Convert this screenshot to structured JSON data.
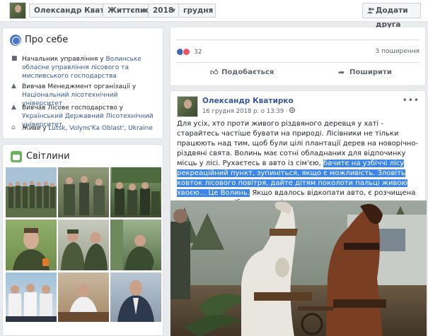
{
  "topbar": {
    "profile_name": "Олександр Кватирко",
    "chronicle_label": "Життєпис",
    "year_label": "2018",
    "month_label": "грудня",
    "add_friend_label": "Додати друга"
  },
  "about": {
    "title": "Про себе",
    "rows": [
      {
        "prefix": "Начальник управління у ",
        "link": "Волинське обласне управління лісового та мисливського господарства",
        "suffix": ""
      },
      {
        "prefix": "Вивчав Менеджмент організації у ",
        "link": "Національний лісотехнічний університет",
        "suffix": ""
      },
      {
        "prefix": "Вивчав Лісове господарство у ",
        "link": "Український Державний Лісотехнічний університет",
        "suffix": ""
      },
      {
        "prefix": "Живе у ",
        "link": "Lutsk, Volyns'Ka Oblast', Ukraine",
        "suffix": ""
      }
    ]
  },
  "photos": {
    "title": "Світлини"
  },
  "post1": {
    "reaction_count": "32",
    "shares": "3 поширення",
    "like_label": "Подобається",
    "share_label": "Поширити"
  },
  "post2": {
    "author": "Олександр Кватирко",
    "date": "16 грудня 2018 р. о 13:39 ·",
    "text_before": "Для усіх, хто проти живого різдвяного деревця у хаті - старайтесь частіше бувати на природі. Лісівники не тільки працюють над тим, щоб були цілі плантації дерев на новорічно-різдвяні свята. Волинь має сотні обладнаних для відпочинку місць у лісі. Рухаєтесь в авто із сім'єю, ",
    "text_highlight": "бачите на узбіччі лісу рекреаційний пункт, зупиніться, якщо є можливість. Зловіть ковток лісового повітря, дайте дітям поколоти пальці живою хвоєю... Це Волинь.",
    "text_after": "Якщо вдалось відкопати авто, є розчищена дорога до потрібного вам місця, можете до лапатих красунь рухатись вже😉"
  },
  "colors": {
    "link": "#365899",
    "highlight": "#3b86e8",
    "background": "#e9ebee"
  }
}
